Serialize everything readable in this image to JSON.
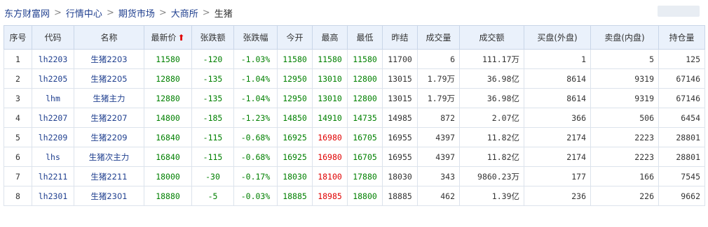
{
  "breadcrumb": {
    "items": [
      "东方财富网",
      "行情中心",
      "期货市场",
      "大商所",
      "生猪"
    ]
  },
  "table": {
    "headers": [
      "序号",
      "代码",
      "名称",
      "最新价",
      "张跌额",
      "张跌幅",
      "今开",
      "最高",
      "最低",
      "昨结",
      "成交量",
      "成交额",
      "买盘(外盘)",
      "卖盘(内盘)",
      "持仓量"
    ],
    "sort_arrow": "⬆",
    "rows": [
      {
        "no": "1",
        "code": "lh2203",
        "name": "生猪2203",
        "last": "11580",
        "chg": "-120",
        "pct": "-1.03%",
        "open": "11580",
        "high": "11580",
        "low": "11580",
        "prev": "11700",
        "vol": "6",
        "amt": "111.17万",
        "buy": "1",
        "sell": "5",
        "oi": "125",
        "high_color": "green"
      },
      {
        "no": "2",
        "code": "lh2205",
        "name": "生猪2205",
        "last": "12880",
        "chg": "-135",
        "pct": "-1.04%",
        "open": "12950",
        "high": "13010",
        "low": "12800",
        "prev": "13015",
        "vol": "1.79万",
        "amt": "36.98亿",
        "buy": "8614",
        "sell": "9319",
        "oi": "67146",
        "high_color": "green"
      },
      {
        "no": "3",
        "code": "lhm",
        "name": "生猪主力",
        "last": "12880",
        "chg": "-135",
        "pct": "-1.04%",
        "open": "12950",
        "high": "13010",
        "low": "12800",
        "prev": "13015",
        "vol": "1.79万",
        "amt": "36.98亿",
        "buy": "8614",
        "sell": "9319",
        "oi": "67146",
        "high_color": "green"
      },
      {
        "no": "4",
        "code": "lh2207",
        "name": "生猪2207",
        "last": "14800",
        "chg": "-185",
        "pct": "-1.23%",
        "open": "14850",
        "high": "14910",
        "low": "14735",
        "prev": "14985",
        "vol": "872",
        "amt": "2.07亿",
        "buy": "366",
        "sell": "506",
        "oi": "6454",
        "high_color": "green"
      },
      {
        "no": "5",
        "code": "lh2209",
        "name": "生猪2209",
        "last": "16840",
        "chg": "-115",
        "pct": "-0.68%",
        "open": "16925",
        "high": "16980",
        "low": "16705",
        "prev": "16955",
        "vol": "4397",
        "amt": "11.82亿",
        "buy": "2174",
        "sell": "2223",
        "oi": "28801",
        "high_color": "red"
      },
      {
        "no": "6",
        "code": "lhs",
        "name": "生猪次主力",
        "last": "16840",
        "chg": "-115",
        "pct": "-0.68%",
        "open": "16925",
        "high": "16980",
        "low": "16705",
        "prev": "16955",
        "vol": "4397",
        "amt": "11.82亿",
        "buy": "2174",
        "sell": "2223",
        "oi": "28801",
        "high_color": "red"
      },
      {
        "no": "7",
        "code": "lh2211",
        "name": "生猪2211",
        "last": "18000",
        "chg": "-30",
        "pct": "-0.17%",
        "open": "18030",
        "high": "18100",
        "low": "17880",
        "prev": "18030",
        "vol": "343",
        "amt": "9860.23万",
        "buy": "177",
        "sell": "166",
        "oi": "7545",
        "high_color": "red"
      },
      {
        "no": "8",
        "code": "lh2301",
        "name": "生猪2301",
        "last": "18880",
        "chg": "-5",
        "pct": "-0.03%",
        "open": "18885",
        "high": "18985",
        "low": "18800",
        "prev": "18885",
        "vol": "462",
        "amt": "1.39亿",
        "buy": "236",
        "sell": "226",
        "oi": "9662",
        "high_color": "red"
      }
    ]
  }
}
